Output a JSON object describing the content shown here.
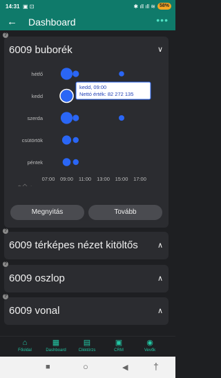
{
  "status_bar": {
    "time": "14:31",
    "battery": "58%",
    "icons_left": "▣ ⊡",
    "icons_right": "✱ ıll ıll ≋"
  },
  "app_bar": {
    "title": "Dashboard",
    "back_icon": "arrow-left-icon",
    "more_icon": "more-dots-icon"
  },
  "cards": [
    {
      "title": "6009 buborék",
      "expanded": true
    },
    {
      "title": "6009 térképes nézet kitöltős",
      "expanded": false
    },
    {
      "title": "6009 oszlop",
      "expanded": false
    },
    {
      "title": "6009 vonal",
      "expanded": false
    }
  ],
  "chart_data": {
    "type": "scatter",
    "categories": [
      "hétfő",
      "kedd",
      "szerda",
      "csütörtök",
      "péntek"
    ],
    "x_ticks": [
      "07:00",
      "09:00",
      "11:00",
      "13:00",
      "15:00",
      "17:00"
    ],
    "points": [
      {
        "day": "hétfő",
        "hour": 9,
        "size": 3
      },
      {
        "day": "hétfő",
        "hour": 10,
        "size": 1
      },
      {
        "day": "hétfő",
        "hour": 15,
        "size": 0.6
      },
      {
        "day": "kedd",
        "hour": 9,
        "size": 3
      },
      {
        "day": "szerda",
        "hour": 9,
        "size": 3
      },
      {
        "day": "szerda",
        "hour": 10,
        "size": 1
      },
      {
        "day": "szerda",
        "hour": 15,
        "size": 0.7
      },
      {
        "day": "csütörtök",
        "hour": 9,
        "size": 2
      },
      {
        "day": "csütörtök",
        "hour": 10,
        "size": 0.8
      },
      {
        "day": "péntek",
        "hour": 9,
        "size": 1.6
      },
      {
        "day": "péntek",
        "hour": 10,
        "size": 0.8
      }
    ],
    "tooltip": {
      "line1": "kedd, 09:00",
      "line2": "Nettó érték: 82 272 135"
    },
    "color": "#2a66f5"
  },
  "buttons": {
    "open": "Megnyitás",
    "next": "Tovább"
  },
  "bottom_nav": [
    {
      "label": "Főoldal",
      "icon": "home-icon"
    },
    {
      "label": "Dashboard",
      "icon": "dashboard-icon"
    },
    {
      "label": "Cikktörzs",
      "icon": "document-icon"
    },
    {
      "label": "CRM",
      "icon": "crm-icon"
    },
    {
      "label": "Vevők",
      "icon": "customers-icon"
    }
  ],
  "help_mark": "?"
}
